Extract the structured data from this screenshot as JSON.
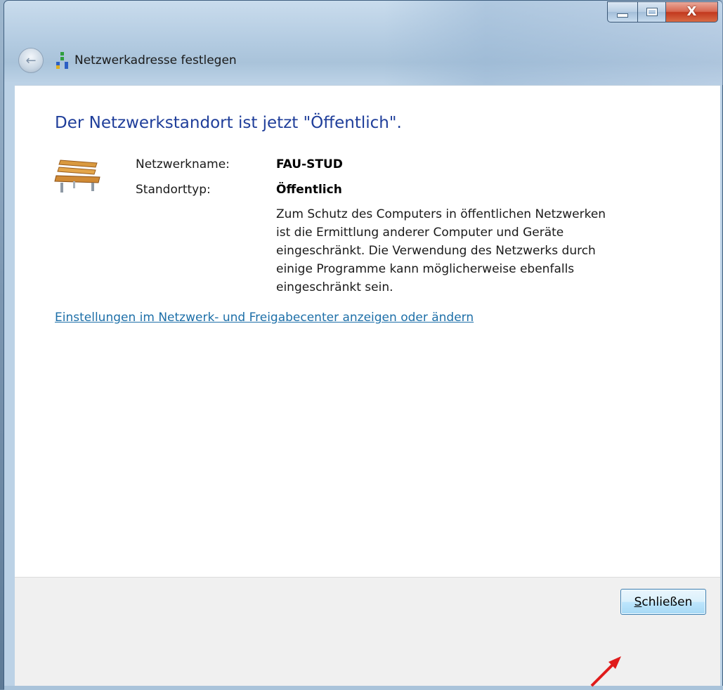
{
  "window": {
    "title": "Netzwerkadresse festlegen",
    "caption_buttons": {
      "minimize": "minimize-icon",
      "maximize": "maximize-icon",
      "close": "close-icon"
    }
  },
  "content": {
    "heading": "Der Netzwerkstandort ist jetzt \"Öffentlich\".",
    "network_name_label": "Netzwerkname:",
    "network_name_value": "FAU-STUD",
    "location_type_label": "Standorttyp:",
    "location_type_value": "Öffentlich",
    "description": "Zum Schutz des Computers in öffentlichen Netzwerken ist die Ermittlung anderer Computer und Geräte eingeschränkt. Die Verwendung des Netzwerks durch einige Programme kann möglicherweise ebenfalls eingeschränkt sein.",
    "settings_link": "Einstellungen im Netzwerk- und Freigabecenter anzeigen oder ändern"
  },
  "footer": {
    "close_button_accel": "S",
    "close_button_rest": "chließen"
  },
  "colors": {
    "heading": "#1f3e9a",
    "link": "#1d6fa8",
    "annotation_arrow": "#e01b1b"
  }
}
